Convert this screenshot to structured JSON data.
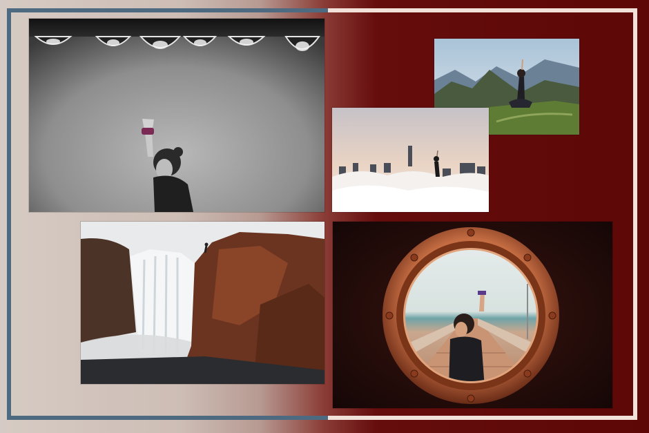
{
  "layout": "photo-collage",
  "colors": {
    "background_left": "#d6cbc4",
    "background_right": "#5d0707",
    "frame_left": "#4e6a80",
    "frame_right": "#f2e1d8"
  },
  "photos": [
    {
      "name": "grayscale-rain-gutter-peace-sign",
      "style": "monochrome"
    },
    {
      "name": "mountain-ruins-pose",
      "style": "color"
    },
    {
      "name": "city-above-clouds-pose",
      "style": "color"
    },
    {
      "name": "waterfall-cliff-pose",
      "style": "color"
    },
    {
      "name": "porthole-pier-peace-sign",
      "style": "color"
    }
  ]
}
